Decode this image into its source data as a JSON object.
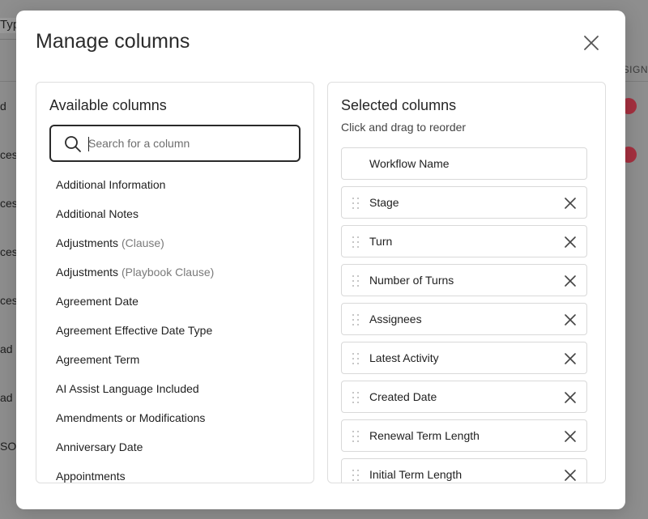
{
  "background": {
    "toolbar_fragment": "Typ",
    "column_fragment": "SSIGN",
    "row_fragments": [
      "d",
      "ces",
      "ces",
      "ces",
      "ces",
      "ad",
      "ad",
      "SOW"
    ]
  },
  "modal": {
    "title": "Manage columns",
    "close_icon": "close-icon"
  },
  "available": {
    "title": "Available columns",
    "search": {
      "placeholder": "Search for a column",
      "value": ""
    },
    "items": [
      {
        "label": "Additional Information",
        "sub": ""
      },
      {
        "label": "Additional Notes",
        "sub": ""
      },
      {
        "label": "Adjustments",
        "sub": "(Clause)"
      },
      {
        "label": "Adjustments",
        "sub": "(Playbook Clause)"
      },
      {
        "label": "Agreement Date",
        "sub": ""
      },
      {
        "label": "Agreement Effective Date Type",
        "sub": ""
      },
      {
        "label": "Agreement Term",
        "sub": ""
      },
      {
        "label": "AI Assist Language Included",
        "sub": ""
      },
      {
        "label": "Amendments or Modifications",
        "sub": ""
      },
      {
        "label": "Anniversary Date",
        "sub": ""
      },
      {
        "label": "Appointments",
        "sub": ""
      }
    ]
  },
  "selected": {
    "title": "Selected columns",
    "subtitle": "Click and drag to reorder",
    "items": [
      {
        "label": "Workflow Name",
        "fixed": true
      },
      {
        "label": "Stage",
        "fixed": false
      },
      {
        "label": "Turn",
        "fixed": false
      },
      {
        "label": "Number of Turns",
        "fixed": false
      },
      {
        "label": "Assignees",
        "fixed": false
      },
      {
        "label": "Latest Activity",
        "fixed": false
      },
      {
        "label": "Created Date",
        "fixed": false
      },
      {
        "label": "Renewal Term Length",
        "fixed": false
      },
      {
        "label": "Initial Term Length",
        "fixed": false
      }
    ]
  },
  "colors": {
    "overlay": "#8e8e8e",
    "badge": "#a5303f",
    "border": "#dedede"
  }
}
